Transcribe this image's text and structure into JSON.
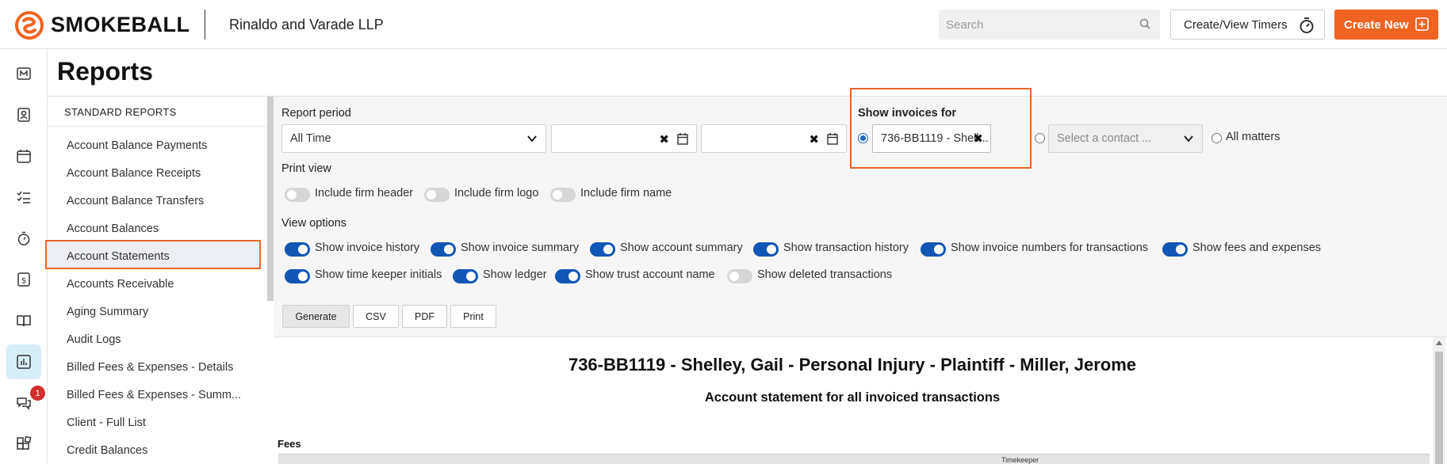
{
  "header": {
    "brand": "SMOKEBALL",
    "firm_name": "Rinaldo and Varade LLP",
    "search_placeholder": "Search",
    "timers_label": "Create/View Timers",
    "create_label": "Create New",
    "brand_color": "#ef6421"
  },
  "rail": {
    "items": [
      {
        "icon": "matters-icon"
      },
      {
        "icon": "contacts-icon"
      },
      {
        "icon": "calendar-icon"
      },
      {
        "icon": "tasks-icon"
      },
      {
        "icon": "timer-icon"
      },
      {
        "icon": "billing-icon"
      },
      {
        "icon": "accounts-icon"
      },
      {
        "icon": "reports-icon",
        "active": true
      },
      {
        "icon": "communicate-icon",
        "badge": "1"
      },
      {
        "icon": "apps-icon"
      }
    ]
  },
  "page": {
    "title": "Reports"
  },
  "reports": {
    "heading": "STANDARD REPORTS",
    "items": [
      "Account Balance Payments",
      "Account Balance Receipts",
      "Account Balance Transfers",
      "Account Balances",
      "Account Statements",
      "Accounts Receivable",
      "Aging Summary",
      "Audit Logs",
      "Billed Fees & Expenses - Details",
      "Billed Fees & Expenses - Summ...",
      "Client - Full List",
      "Credit Balances"
    ],
    "selected": "Account Statements"
  },
  "options": {
    "report_period_label": "Report period",
    "report_period_value": "All Time",
    "show_invoices_label": "Show invoices for",
    "matter_value": "736-BB1119 - Shell...",
    "contact_placeholder": "Select a contact ...",
    "all_matters_label": "All matters",
    "print_view_label": "Print view",
    "print_view": [
      {
        "label": "Include firm header",
        "on": false
      },
      {
        "label": "Include firm logo",
        "on": false
      },
      {
        "label": "Include firm name",
        "on": false
      }
    ],
    "view_options_label": "View options",
    "view_options_row1": [
      {
        "label": "Show invoice history",
        "on": true
      },
      {
        "label": "Show invoice summary",
        "on": true
      },
      {
        "label": "Show account summary",
        "on": true
      },
      {
        "label": "Show transaction history",
        "on": true
      },
      {
        "label": "Show invoice numbers for transactions",
        "on": true
      },
      {
        "label": "Show fees and expenses",
        "on": true
      }
    ],
    "view_options_row2": [
      {
        "label": "Show time keeper initials",
        "on": true
      },
      {
        "label": "Show ledger",
        "on": true
      },
      {
        "label": "Show trust account name",
        "on": true
      },
      {
        "label": "Show deleted transactions",
        "on": false
      }
    ],
    "buttons": {
      "generate": "Generate",
      "csv": "CSV",
      "pdf": "PDF",
      "print": "Print"
    }
  },
  "preview": {
    "title": "736-BB1119 - Shelley, Gail - Personal Injury - Plaintiff - Miller, Jerome",
    "subtitle": "Account statement for all invoiced transactions",
    "fees_label": "Fees",
    "table_header_partial": "Timekeeper"
  }
}
